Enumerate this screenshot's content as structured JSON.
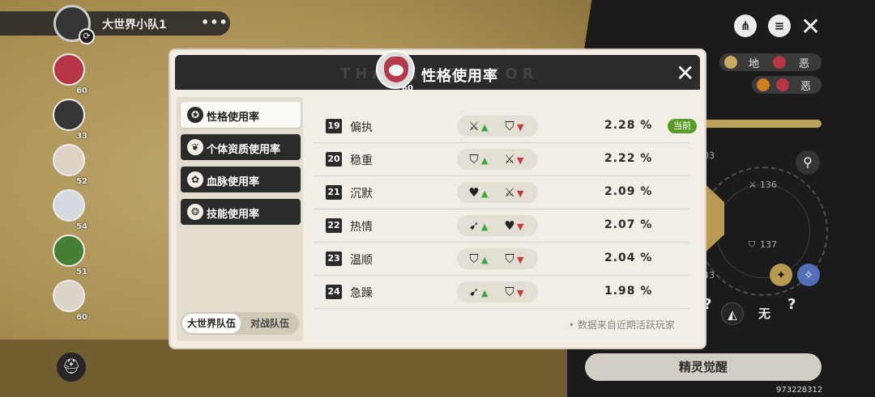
{
  "team": {
    "name": "大世界小队1",
    "menu": "•••"
  },
  "side_members": [
    {
      "level": "60",
      "color": "#c63b4d"
    },
    {
      "level": "33",
      "color": "#3a3a3a"
    },
    {
      "level": "52",
      "color": "#f0e6d8"
    },
    {
      "level": "54",
      "color": "#e9eef5"
    },
    {
      "level": "51",
      "color": "#4a8a3a"
    },
    {
      "level": "60",
      "color": "#efe6dc"
    }
  ],
  "attributes": [
    {
      "type": "地",
      "trait": "恶"
    },
    {
      "type": "",
      "trait": "恶"
    }
  ],
  "stats": {
    "attack": "136",
    "defense": "137",
    "top": "03",
    "bottom": "43"
  },
  "element_label": "无",
  "awaken_button": "精灵觉醒",
  "player_id": "973228312",
  "modal": {
    "title": "性格使用率",
    "watermark": "THANK YOU FOR",
    "pet_level": "60",
    "close": "✕",
    "tabs": [
      {
        "label": "性格使用率",
        "icon": "✪",
        "active": true
      },
      {
        "label": "个体资质使用率",
        "icon": "❦",
        "active": false
      },
      {
        "label": "血脉使用率",
        "icon": "✿",
        "active": false
      },
      {
        "label": "技能使用率",
        "icon": "❂",
        "active": false
      }
    ],
    "team_toggle": {
      "on": "大世界队伍",
      "off": "对战队伍"
    },
    "rows": [
      {
        "rank": "19",
        "name": "偏执",
        "up_icon": "⚔",
        "down_icon": "⛉",
        "percent": "2.28 %",
        "current": "当前"
      },
      {
        "rank": "20",
        "name": "稳重",
        "up_icon": "⛉",
        "down_icon": "⚔",
        "percent": "2.22 %"
      },
      {
        "rank": "21",
        "name": "沉默",
        "up_icon": "♥",
        "down_icon": "⚔",
        "percent": "2.09 %"
      },
      {
        "rank": "22",
        "name": "热情",
        "up_icon": "➹",
        "down_icon": "♥",
        "percent": "2.07 %"
      },
      {
        "rank": "23",
        "name": "温顺",
        "up_icon": "⛉",
        "down_icon": "⛉",
        "percent": "2.04 %"
      },
      {
        "rank": "24",
        "name": "急躁",
        "up_icon": "➹",
        "down_icon": "⛉",
        "percent": "1.98 %"
      }
    ],
    "note": "• 数据来自近期活跃玩家"
  },
  "colors": {
    "accent_green": "#5a9a2a",
    "up_arrow": "#3aa83a",
    "down_arrow": "#c23a3a",
    "dark": "#2b2b2b"
  }
}
